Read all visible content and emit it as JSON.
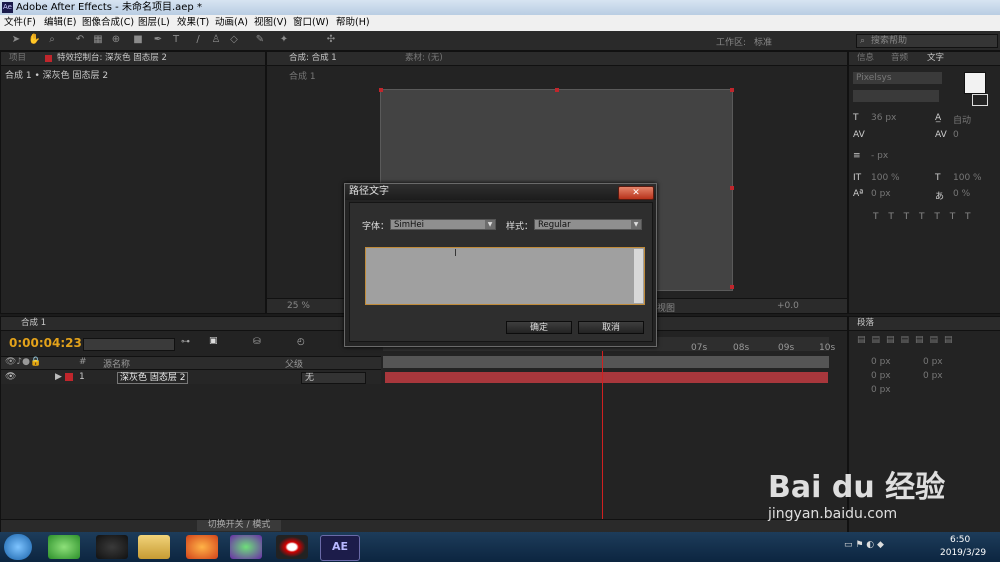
{
  "window": {
    "title": "Adobe After Effects - 未命名项目.aep *"
  },
  "menu": [
    "文件(F)",
    "编辑(E)",
    "图像合成(C)",
    "图层(L)",
    "效果(T)",
    "动画(A)",
    "视图(V)",
    "窗口(W)",
    "帮助(H)"
  ],
  "toolbar": {
    "workspace_label": "工作区:",
    "workspace_value": "标准",
    "search_placeholder": "搜索帮助"
  },
  "project_panel": {
    "tab_project": "项目",
    "tab_effects": "特效控制台: 深灰色 固态层 2",
    "header": "合成 1 • 深灰色 固态层 2"
  },
  "comp_panel": {
    "tab_comp": "合成: 合成 1",
    "tab_footage": "素材: (无)",
    "sub_label": "合成 1",
    "zoom": "25 %",
    "view_label": "视图",
    "exposure": "+0.0"
  },
  "char_panel": {
    "tab_info": "信息",
    "tab_audio": "音频",
    "tab_char": "文字",
    "font_name": "Pixelsys",
    "size": "36 px",
    "leading": "自动",
    "kerning": "0",
    "stroke_unit": "- px",
    "vscale": "100 %",
    "hscale": "100 %",
    "baseline": "0 px",
    "tsume": "0 %"
  },
  "paragraph_panel": {
    "tab": "段落",
    "indent1": "0 px",
    "indent2": "0 px",
    "indent3": "0 px",
    "space1": "0 px",
    "space2": "0 px"
  },
  "timeline": {
    "tab": "合成 1",
    "timecode": "0:00:04:23",
    "col_layer_name": "源名称",
    "col_parent": "父级",
    "layer_index": "1",
    "layer_name": "深灰色 固态层 2",
    "parent_value": "无",
    "ruler_labels": [
      "07s",
      "08s",
      "09s",
      "10s"
    ],
    "switch_toggle": "切换开关 / 模式",
    "layer_color": "#c0262c"
  },
  "dialog": {
    "title": "路径文字",
    "font_label": "字体：",
    "font_value": "SimHei",
    "style_label": "样式：",
    "style_value": "Regular",
    "ok_label": "确定",
    "cancel_label": "取消"
  },
  "taskbar": {
    "time": "6:50",
    "date": "2019/3/29",
    "ae_label": "AE"
  },
  "watermark": {
    "brand": "Bai du 经验",
    "url": "jingyan.baidu.com"
  }
}
